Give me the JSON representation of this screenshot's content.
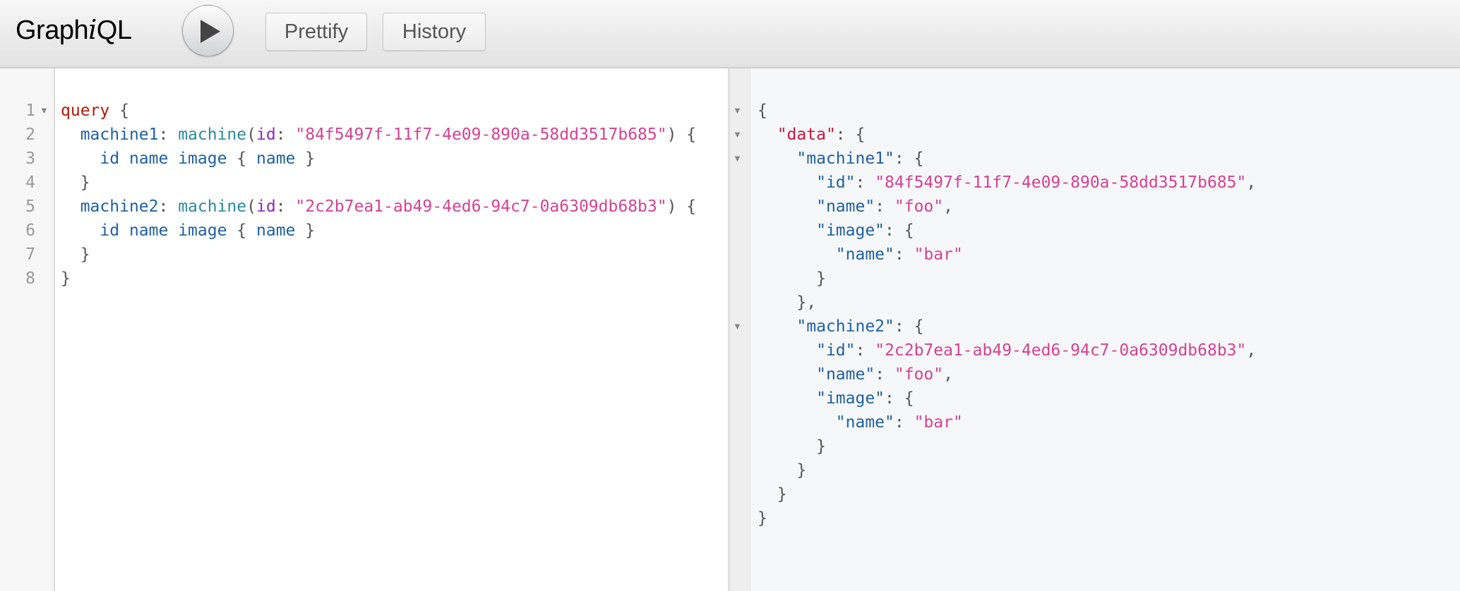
{
  "toolbar": {
    "logo_prefix": "Graph",
    "logo_italic": "i",
    "logo_suffix": "QL",
    "execute_icon": "play-icon",
    "prettify_label": "Prettify",
    "history_label": "History"
  },
  "query_editor": {
    "line_numbers": [
      "1",
      "2",
      "3",
      "4",
      "5",
      "6",
      "7",
      "8"
    ],
    "lines": [
      [
        {
          "t": "query",
          "c": "kw"
        },
        {
          "t": " {",
          "c": "punct"
        }
      ],
      [
        {
          "t": "  ",
          "c": "punct"
        },
        {
          "t": "machine1",
          "c": "prop"
        },
        {
          "t": ": ",
          "c": "punct"
        },
        {
          "t": "machine",
          "c": "field"
        },
        {
          "t": "(",
          "c": "punct"
        },
        {
          "t": "id",
          "c": "attr"
        },
        {
          "t": ": ",
          "c": "punct"
        },
        {
          "t": "\"84f5497f-11f7-4e09-890a-58dd3517b685\"",
          "c": "str"
        },
        {
          "t": ") {",
          "c": "punct"
        }
      ],
      [
        {
          "t": "    ",
          "c": "punct"
        },
        {
          "t": "id",
          "c": "def"
        },
        {
          "t": " ",
          "c": "punct"
        },
        {
          "t": "name",
          "c": "def"
        },
        {
          "t": " ",
          "c": "punct"
        },
        {
          "t": "image",
          "c": "def"
        },
        {
          "t": " { ",
          "c": "punct"
        },
        {
          "t": "name",
          "c": "def"
        },
        {
          "t": " }",
          "c": "punct"
        }
      ],
      [
        {
          "t": "  }",
          "c": "punct"
        }
      ],
      [
        {
          "t": "  ",
          "c": "punct"
        },
        {
          "t": "machine2",
          "c": "prop"
        },
        {
          "t": ": ",
          "c": "punct"
        },
        {
          "t": "machine",
          "c": "field"
        },
        {
          "t": "(",
          "c": "punct"
        },
        {
          "t": "id",
          "c": "attr"
        },
        {
          "t": ": ",
          "c": "punct"
        },
        {
          "t": "\"2c2b7ea1-ab49-4ed6-94c7-0a6309db68b3\"",
          "c": "str"
        },
        {
          "t": ") {",
          "c": "punct"
        }
      ],
      [
        {
          "t": "    ",
          "c": "punct"
        },
        {
          "t": "id",
          "c": "def"
        },
        {
          "t": " ",
          "c": "punct"
        },
        {
          "t": "name",
          "c": "def"
        },
        {
          "t": " ",
          "c": "punct"
        },
        {
          "t": "image",
          "c": "def"
        },
        {
          "t": " { ",
          "c": "punct"
        },
        {
          "t": "name",
          "c": "def"
        },
        {
          "t": " }",
          "c": "punct"
        }
      ],
      [
        {
          "t": "  }",
          "c": "punct"
        }
      ],
      [
        {
          "t": "}",
          "c": "punct"
        }
      ]
    ],
    "fold_markers": [
      0
    ]
  },
  "result_viewer": {
    "lines": [
      [
        {
          "t": "{",
          "c": "punct"
        }
      ],
      [
        {
          "t": "  ",
          "c": "punct"
        },
        {
          "t": "\"data\"",
          "c": "jdata"
        },
        {
          "t": ": {",
          "c": "punct"
        }
      ],
      [
        {
          "t": "    ",
          "c": "punct"
        },
        {
          "t": "\"machine1\"",
          "c": "prop"
        },
        {
          "t": ": {",
          "c": "punct"
        }
      ],
      [
        {
          "t": "      ",
          "c": "punct"
        },
        {
          "t": "\"id\"",
          "c": "prop"
        },
        {
          "t": ": ",
          "c": "punct"
        },
        {
          "t": "\"84f5497f-11f7-4e09-890a-58dd3517b685\"",
          "c": "str"
        },
        {
          "t": ",",
          "c": "punct"
        }
      ],
      [
        {
          "t": "      ",
          "c": "punct"
        },
        {
          "t": "\"name\"",
          "c": "prop"
        },
        {
          "t": ": ",
          "c": "punct"
        },
        {
          "t": "\"foo\"",
          "c": "str"
        },
        {
          "t": ",",
          "c": "punct"
        }
      ],
      [
        {
          "t": "      ",
          "c": "punct"
        },
        {
          "t": "\"image\"",
          "c": "prop"
        },
        {
          "t": ": {",
          "c": "punct"
        }
      ],
      [
        {
          "t": "        ",
          "c": "punct"
        },
        {
          "t": "\"name\"",
          "c": "prop"
        },
        {
          "t": ": ",
          "c": "punct"
        },
        {
          "t": "\"bar\"",
          "c": "str"
        }
      ],
      [
        {
          "t": "      }",
          "c": "punct"
        }
      ],
      [
        {
          "t": "    },",
          "c": "punct"
        }
      ],
      [
        {
          "t": "    ",
          "c": "punct"
        },
        {
          "t": "\"machine2\"",
          "c": "prop"
        },
        {
          "t": ": {",
          "c": "punct"
        }
      ],
      [
        {
          "t": "      ",
          "c": "punct"
        },
        {
          "t": "\"id\"",
          "c": "prop"
        },
        {
          "t": ": ",
          "c": "punct"
        },
        {
          "t": "\"2c2b7ea1-ab49-4ed6-94c7-0a6309db68b3\"",
          "c": "str"
        },
        {
          "t": ",",
          "c": "punct"
        }
      ],
      [
        {
          "t": "      ",
          "c": "punct"
        },
        {
          "t": "\"name\"",
          "c": "prop"
        },
        {
          "t": ": ",
          "c": "punct"
        },
        {
          "t": "\"foo\"",
          "c": "str"
        },
        {
          "t": ",",
          "c": "punct"
        }
      ],
      [
        {
          "t": "      ",
          "c": "punct"
        },
        {
          "t": "\"image\"",
          "c": "prop"
        },
        {
          "t": ": {",
          "c": "punct"
        }
      ],
      [
        {
          "t": "        ",
          "c": "punct"
        },
        {
          "t": "\"name\"",
          "c": "prop"
        },
        {
          "t": ": ",
          "c": "punct"
        },
        {
          "t": "\"bar\"",
          "c": "str"
        }
      ],
      [
        {
          "t": "      }",
          "c": "punct"
        }
      ],
      [
        {
          "t": "    }",
          "c": "punct"
        }
      ],
      [
        {
          "t": "  }",
          "c": "punct"
        }
      ],
      [
        {
          "t": "}",
          "c": "punct"
        }
      ]
    ],
    "fold_markers": [
      0,
      1,
      2,
      9
    ]
  },
  "colors": {
    "keyword": "#b11a04",
    "property": "#1f61a0",
    "field": "#2a8c9e",
    "attribute": "#8b2bb9",
    "string": "#d64292",
    "json_data_key": "#c41a3c",
    "punctuation": "#555555",
    "result_bg": "#f6f7f8"
  }
}
